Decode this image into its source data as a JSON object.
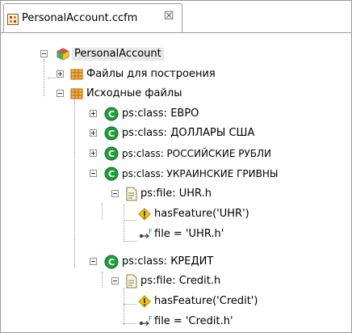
{
  "tab": {
    "title": "PersonalAccount.ccfm",
    "close_glyph": "☒"
  },
  "tree": {
    "root": "PersonalAccount",
    "build_files": "Файлы для построения",
    "source_files": "Исходные файлы",
    "class_euro": "ps:class: ЕВРО",
    "class_usd": "ps:class: ДОЛЛАРЫ США",
    "class_rub": "ps:class: РОССИЙСКИЕ РУБЛИ",
    "class_uah": "ps:class: УКРАИНСКИЕ ГРИВНЫ",
    "file_uhr": "ps:file: UHR.h",
    "feature_uhr": "hasFeature('UHR')",
    "assign_uhr": "file = 'UHR.h'",
    "class_credit": "ps:class: КРЕДИТ",
    "file_credit": "ps:file: Credit.h",
    "feature_credit": "hasFeature('Credit')",
    "assign_credit": "file = 'Credit.h'"
  },
  "colors": {
    "class_green": "#1e9e3a",
    "folder_orange": "#d98a1a",
    "warn_yellow": "#f2c40c"
  }
}
